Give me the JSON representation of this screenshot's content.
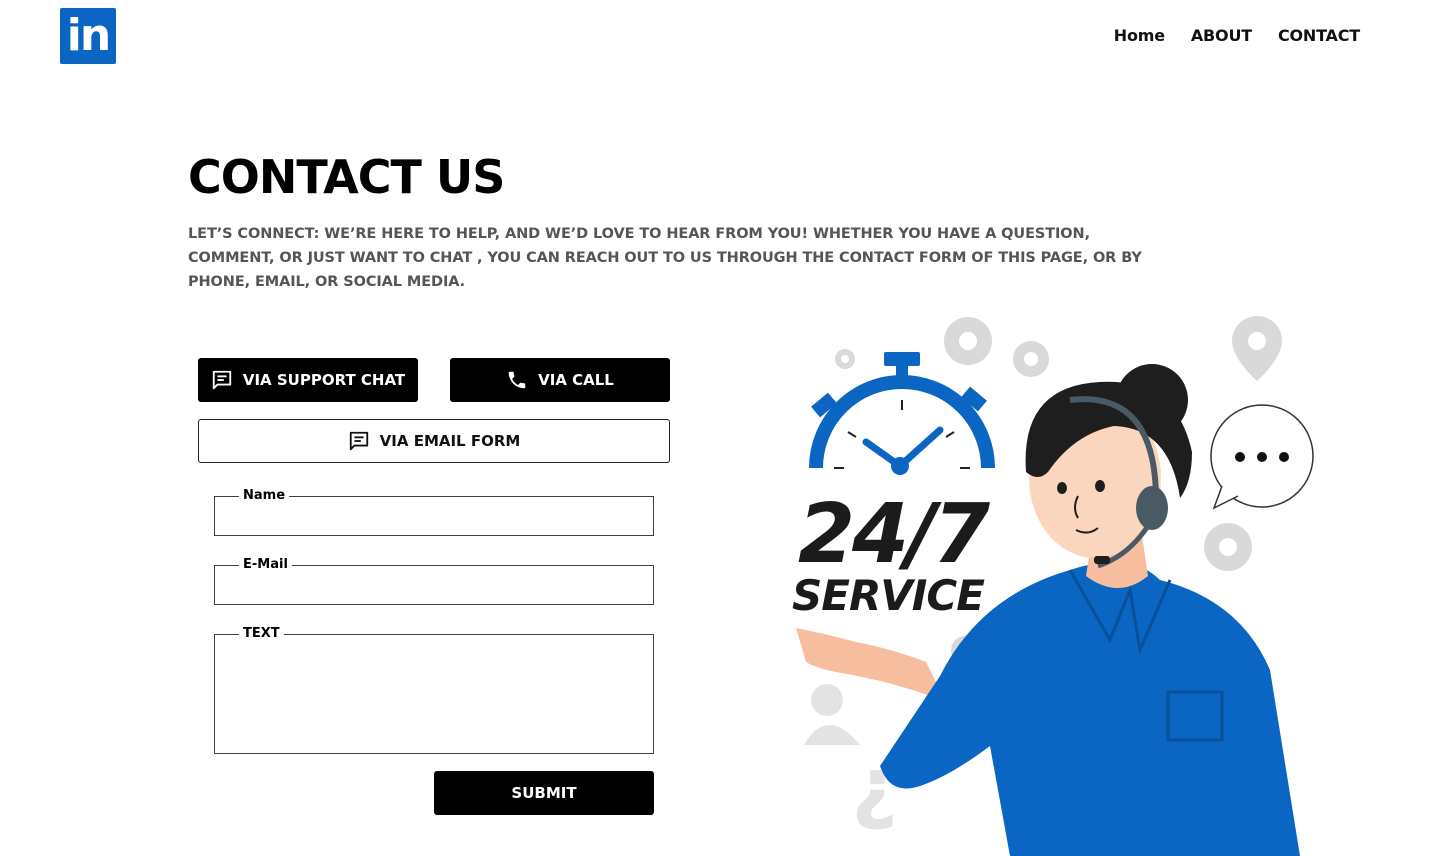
{
  "brand": {
    "logo_text": "in",
    "color": "#0a66c2"
  },
  "nav": {
    "items": [
      "Home",
      "ABOUT",
      "CONTACT"
    ]
  },
  "hero": {
    "title": "CONTACT US",
    "intro": "LET’S CONNECT: WE’RE HERE TO HELP, AND WE’D LOVE TO HEAR FROM YOU! WHETHER YOU HAVE A QUESTION, COMMENT, OR JUST WANT TO CHAT , YOU CAN REACH OUT TO US THROUGH THE CONTACT FORM OF THIS PAGE, OR BY PHONE, EMAIL, OR SOCIAL MEDIA."
  },
  "contact_options": {
    "support_chat": {
      "label": "VIA SUPPORT CHAT",
      "icon": "chat-icon"
    },
    "call": {
      "label": "VIA CALL",
      "icon": "phone-icon"
    },
    "email_form": {
      "label": "VIA EMAIL FORM",
      "icon": "chat-icon"
    }
  },
  "form": {
    "name_label": "Name",
    "name_value": "",
    "email_label": "E-Mail",
    "email_value": "",
    "text_label": "TEXT",
    "text_value": "",
    "submit_label": "SUBMIT"
  },
  "illustration": {
    "badge_top": "24/7",
    "badge_bottom": "SERVICE",
    "accent_color": "#0a66c2",
    "shirt_color": "#0a66c2"
  }
}
